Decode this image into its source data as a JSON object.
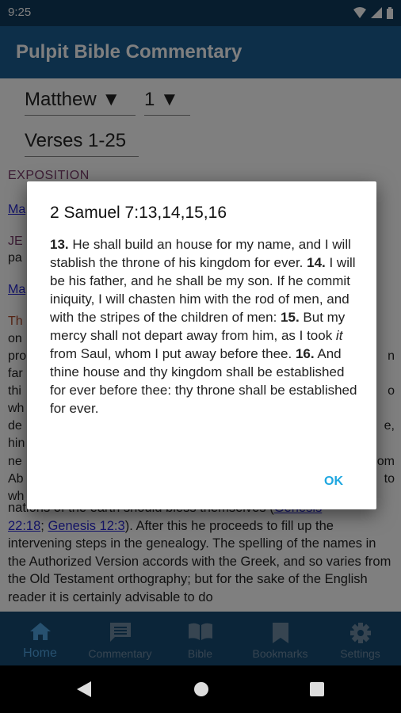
{
  "status": {
    "time": "9:25"
  },
  "app": {
    "title": "Pulpit Bible Commentary"
  },
  "selector": {
    "book": "Matthew ▼",
    "chapter": "1 ▼",
    "verses": "Verses 1-25"
  },
  "background": {
    "exposition": "EXPOSITION",
    "left_fragments": [
      "Ma",
      "JE",
      "pa",
      "Ma",
      "Th",
      "on",
      "pro",
      "far",
      "thi",
      "wh",
      "de",
      "hin",
      "ne",
      "Ab",
      "wh"
    ],
    "right_fragments": [
      "n",
      "o",
      "e,",
      "om",
      "to"
    ],
    "body_line_1": "nations of the earth should bless themselves (",
    "link_1": "Genesis",
    "link_1b": "22:18",
    "link_2": "Genesis 12:3",
    "body_rest": "). After this he proceeds to fill up the intervening steps in the genealogy. The spelling of the names in the Authorized Version accords with the Greek, and so varies from the Old Testament orthography; but for the sake of the English reader it is certainly advisable to do"
  },
  "dialog": {
    "title": "2 Samuel 7:13,14,15,16",
    "v13_num": "13.",
    "v13": " He shall build an house for my name, and I will stablish the throne of his kingdom for ever. ",
    "v14_num": "14.",
    "v14": " I will be his father, and he shall be my son. If he commit iniquity, I will chasten him with the rod of men, and with the stripes of the children of men: ",
    "v15_num": "15.",
    "v15a": " But my mercy shall not depart away from him, as I took ",
    "v15_it": "it",
    "v15b": " from Saul, whom I put away before thee. ",
    "v16_num": "16.",
    "v16": " And thine house and thy kingdom shall be established for ever before thee: thy throne shall be established for ever.",
    "ok": "OK"
  },
  "bottom_nav": {
    "items": [
      {
        "label": "Home",
        "active": true
      },
      {
        "label": "Commentary",
        "active": false
      },
      {
        "label": "Bible",
        "active": false
      },
      {
        "label": "Bookmarks",
        "active": false
      },
      {
        "label": "Settings",
        "active": false
      }
    ],
    "active_color": "#4fa3e0",
    "inactive_color": "#6e8aa3"
  }
}
